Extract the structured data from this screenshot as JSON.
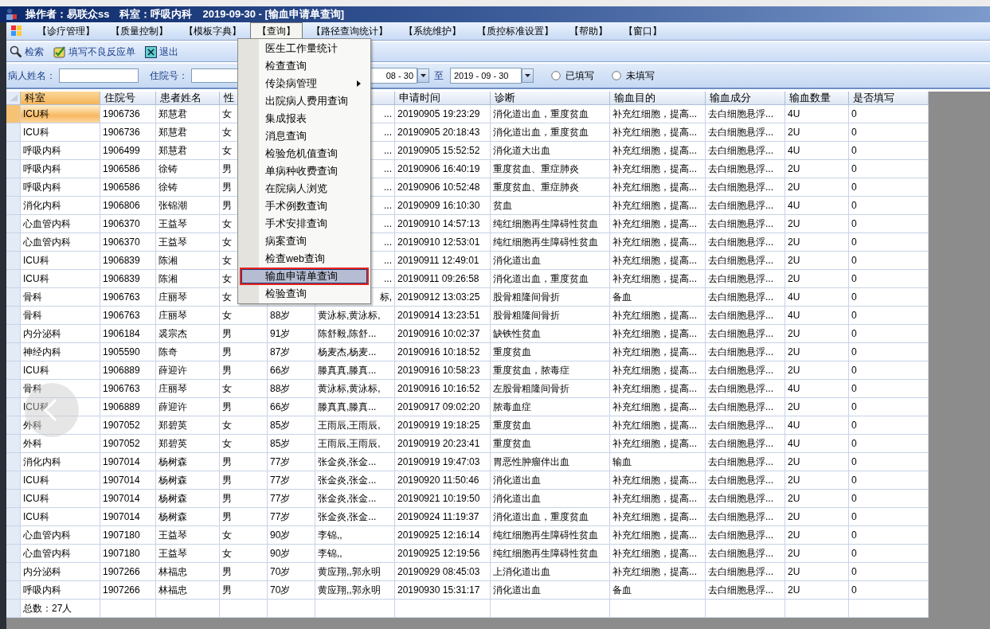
{
  "title": "操作者：易联众ss　科室：呼吸内科　2019-09-30 - [输血申请单查询]",
  "menubar": [
    {
      "label": "【诊疗管理】",
      "selected": false
    },
    {
      "label": "【质量控制】",
      "selected": false
    },
    {
      "label": "【模板字典】",
      "selected": false
    },
    {
      "label": "【查询】",
      "selected": true
    },
    {
      "label": "【路径查询统计】",
      "selected": false
    },
    {
      "label": "【系统维护】",
      "selected": false
    },
    {
      "label": "【质控标准设置】",
      "selected": false
    },
    {
      "label": "【帮助】",
      "selected": false
    },
    {
      "label": "【窗口】",
      "selected": false
    }
  ],
  "toolbar": [
    {
      "label": "检索",
      "kind": "search"
    },
    {
      "label": "填写不良反应单",
      "kind": "form"
    },
    {
      "label": "退出",
      "kind": "exit"
    }
  ],
  "filters": {
    "name_label": "病人姓名：",
    "admission_label": "住院号：",
    "date_from": "08 - 30",
    "to_label": "至",
    "date_to": "2019 - 09 - 30",
    "radios": [
      {
        "label": "已填写",
        "checked": false
      },
      {
        "label": "未填写",
        "checked": false
      }
    ]
  },
  "table": {
    "header": {
      "dept": "科室",
      "id": "住院号",
      "name": "患者姓名",
      "sex": "性",
      "time": "申请时间",
      "diagnosis": "诊断",
      "purpose": "输血目的",
      "component": "输血成分",
      "amount": "输血数量",
      "filled": "是否填写"
    },
    "rows": [
      {
        "selected": true,
        "under_menu": true,
        "dept": "ICU科",
        "id": "1906736",
        "name": "郑慧君",
        "sex": "女",
        "doctor": "...",
        "time": "20190905 19:23:29",
        "diagnosis": "消化道出血，重度贫血",
        "purpose": "补充红细胞，提高...",
        "component": "去白细胞悬浮...",
        "amount": "4U",
        "filled": "0"
      },
      {
        "selected": false,
        "under_menu": true,
        "dept": "ICU科",
        "id": "1906736",
        "name": "郑慧君",
        "sex": "女",
        "doctor": "...",
        "time": "20190905 20:18:43",
        "diagnosis": "消化道出血，重度贫血",
        "purpose": "补充红细胞，提高...",
        "component": "去白细胞悬浮...",
        "amount": "2U",
        "filled": "0"
      },
      {
        "selected": false,
        "under_menu": true,
        "dept": "呼吸内科",
        "id": "1906499",
        "name": "郑慧君",
        "sex": "女",
        "doctor": "...",
        "time": "20190905 15:52:52",
        "diagnosis": "消化道大出血",
        "purpose": "补充红细胞，提高...",
        "component": "去白细胞悬浮...",
        "amount": "4U",
        "filled": "0"
      },
      {
        "selected": false,
        "under_menu": true,
        "dept": "呼吸内科",
        "id": "1906586",
        "name": "徐铸",
        "sex": "男",
        "doctor": "...",
        "time": "20190906 16:40:19",
        "diagnosis": "重度贫血、重症肺炎",
        "purpose": "补充红细胞，提高...",
        "component": "去白细胞悬浮...",
        "amount": "2U",
        "filled": "0"
      },
      {
        "selected": false,
        "under_menu": true,
        "dept": "呼吸内科",
        "id": "1906586",
        "name": "徐铸",
        "sex": "男",
        "doctor": "...",
        "time": "20190906 10:52:48",
        "diagnosis": "重度贫血、重症肺炎",
        "purpose": "补充红细胞，提高...",
        "component": "去白细胞悬浮...",
        "amount": "2U",
        "filled": "0"
      },
      {
        "selected": false,
        "under_menu": true,
        "dept": "消化内科",
        "id": "1906806",
        "name": "张锦潮",
        "sex": "男",
        "doctor": "...",
        "time": "20190909 16:10:30",
        "diagnosis": "贫血",
        "purpose": "补充红细胞，提高...",
        "component": "去白细胞悬浮...",
        "amount": "4U",
        "filled": "0"
      },
      {
        "selected": false,
        "under_menu": true,
        "dept": "心血管内科",
        "id": "1906370",
        "name": "王益琴",
        "sex": "女",
        "doctor": "...",
        "time": "20190910 14:57:13",
        "diagnosis": "纯红细胞再生障碍性贫血",
        "purpose": "补充红细胞，提高...",
        "component": "去白细胞悬浮...",
        "amount": "2U",
        "filled": "0"
      },
      {
        "selected": false,
        "under_menu": true,
        "dept": "心血管内科",
        "id": "1906370",
        "name": "王益琴",
        "sex": "女",
        "doctor": "...",
        "time": "20190910 12:53:01",
        "diagnosis": "纯红细胞再生障碍性贫血",
        "purpose": "补充红细胞，提高...",
        "component": "去白细胞悬浮...",
        "amount": "2U",
        "filled": "0"
      },
      {
        "selected": false,
        "under_menu": true,
        "dept": "ICU科",
        "id": "1906839",
        "name": "陈湘",
        "sex": "女",
        "doctor": "...",
        "time": "20190911 12:49:01",
        "diagnosis": "消化道出血",
        "purpose": "补充红细胞，提高...",
        "component": "去白细胞悬浮...",
        "amount": "2U",
        "filled": "0"
      },
      {
        "selected": false,
        "under_menu": true,
        "dept": "ICU科",
        "id": "1906839",
        "name": "陈湘",
        "sex": "女",
        "doctor": "...",
        "time": "20190911 09:26:58",
        "diagnosis": "消化道出血，重度贫血",
        "purpose": "补充红细胞，提高...",
        "component": "去白细胞悬浮...",
        "amount": "2U",
        "filled": "0"
      },
      {
        "selected": false,
        "under_menu": true,
        "dept": "骨科",
        "id": "1906763",
        "name": "庄丽琴",
        "sex": "女",
        "doctor": "标,",
        "time": "20190912 13:03:25",
        "diagnosis": "股骨粗隆间骨折",
        "purpose": "备血",
        "component": "去白细胞悬浮...",
        "amount": "4U",
        "filled": "0"
      },
      {
        "selected": false,
        "under_menu": false,
        "dept": "骨科",
        "id": "1906763",
        "name": "庄丽琴",
        "sex": "女",
        "age": "88岁",
        "doctor": "黄泳标,黄泳标,",
        "time": "20190914 13:23:51",
        "diagnosis": "股骨粗隆间骨折",
        "purpose": "补充红细胞，提高...",
        "component": "去白细胞悬浮...",
        "amount": "4U",
        "filled": "0"
      },
      {
        "selected": false,
        "under_menu": false,
        "dept": "内分泌科",
        "id": "1906184",
        "name": "裘宗杰",
        "sex": "男",
        "age": "91岁",
        "doctor": "陈舒毅,陈舒...",
        "time": "20190916 10:02:37",
        "diagnosis": "缺铁性贫血",
        "purpose": "补充红细胞，提高...",
        "component": "去白细胞悬浮...",
        "amount": "2U",
        "filled": "0"
      },
      {
        "selected": false,
        "under_menu": false,
        "dept": "神经内科",
        "id": "1905590",
        "name": "陈奇",
        "sex": "男",
        "age": "87岁",
        "doctor": "杨麦杰,杨麦...",
        "time": "20190916 10:18:52",
        "diagnosis": "重度贫血",
        "purpose": "补充红细胞，提高...",
        "component": "去白细胞悬浮...",
        "amount": "2U",
        "filled": "0"
      },
      {
        "selected": false,
        "under_menu": false,
        "dept": "ICU科",
        "id": "1906889",
        "name": "薛迎许",
        "sex": "男",
        "age": "66岁",
        "doctor": "滕真真,滕真...",
        "time": "20190916 10:58:23",
        "diagnosis": "重度贫血，脓毒症",
        "purpose": "补充红细胞，提高...",
        "component": "去白细胞悬浮...",
        "amount": "2U",
        "filled": "0"
      },
      {
        "selected": false,
        "under_menu": false,
        "dept": "骨科",
        "id": "1906763",
        "name": "庄丽琴",
        "sex": "女",
        "age": "88岁",
        "doctor": "黄泳标,黄泳标,",
        "time": "20190916 10:16:52",
        "diagnosis": "左股骨粗隆间骨折",
        "purpose": "补充红细胞，提高...",
        "component": "去白细胞悬浮...",
        "amount": "4U",
        "filled": "0"
      },
      {
        "selected": false,
        "under_menu": false,
        "dept": "ICU科",
        "id": "1906889",
        "name": "薛迎许",
        "sex": "男",
        "age": "66岁",
        "doctor": "滕真真,滕真...",
        "time": "20190917 09:02:20",
        "diagnosis": "脓毒血症",
        "purpose": "补充红细胞，提高...",
        "component": "去白细胞悬浮...",
        "amount": "2U",
        "filled": "0"
      },
      {
        "selected": false,
        "under_menu": false,
        "dept": "外科",
        "id": "1907052",
        "name": "郑碧英",
        "sex": "女",
        "age": "85岁",
        "doctor": "王雨辰,王雨辰,",
        "time": "20190919 19:18:25",
        "diagnosis": "重度贫血",
        "purpose": "补充红细胞，提高...",
        "component": "去白细胞悬浮...",
        "amount": "4U",
        "filled": "0"
      },
      {
        "selected": false,
        "under_menu": false,
        "dept": "外科",
        "id": "1907052",
        "name": "郑碧英",
        "sex": "女",
        "age": "85岁",
        "doctor": "王雨辰,王雨辰,",
        "time": "20190919 20:23:41",
        "diagnosis": "重度贫血",
        "purpose": "补充红细胞，提高...",
        "component": "去白细胞悬浮...",
        "amount": "4U",
        "filled": "0"
      },
      {
        "selected": false,
        "under_menu": false,
        "dept": "消化内科",
        "id": "1907014",
        "name": "杨树森",
        "sex": "男",
        "age": "77岁",
        "doctor": "张金炎,张金...",
        "time": "20190919 19:47:03",
        "diagnosis": "胃恶性肿瘤伴出血",
        "purpose": "输血",
        "component": "去白细胞悬浮...",
        "amount": "2U",
        "filled": "0"
      },
      {
        "selected": false,
        "under_menu": false,
        "dept": "ICU科",
        "id": "1907014",
        "name": "杨树森",
        "sex": "男",
        "age": "77岁",
        "doctor": "张金炎,张金...",
        "time": "20190920 11:50:46",
        "diagnosis": "消化道出血",
        "purpose": "补充红细胞，提高...",
        "component": "去白细胞悬浮...",
        "amount": "2U",
        "filled": "0"
      },
      {
        "selected": false,
        "under_menu": false,
        "dept": "ICU科",
        "id": "1907014",
        "name": "杨树森",
        "sex": "男",
        "age": "77岁",
        "doctor": "张金炎,张金...",
        "time": "20190921 10:19:50",
        "diagnosis": "消化道出血",
        "purpose": "补充红细胞，提高...",
        "component": "去白细胞悬浮...",
        "amount": "2U",
        "filled": "0"
      },
      {
        "selected": false,
        "under_menu": false,
        "dept": "ICU科",
        "id": "1907014",
        "name": "杨树森",
        "sex": "男",
        "age": "77岁",
        "doctor": "张金炎,张金...",
        "time": "20190924 11:19:37",
        "diagnosis": "消化道出血，重度贫血",
        "purpose": "补充红细胞，提高...",
        "component": "去白细胞悬浮...",
        "amount": "2U",
        "filled": "0"
      },
      {
        "selected": false,
        "under_menu": false,
        "dept": "心血管内科",
        "id": "1907180",
        "name": "王益琴",
        "sex": "女",
        "age": "90岁",
        "doctor": "李锦,,",
        "time": "20190925 12:16:14",
        "diagnosis": "纯红细胞再生障碍性贫血",
        "purpose": "补充红细胞，提高...",
        "component": "去白细胞悬浮...",
        "amount": "2U",
        "filled": "0"
      },
      {
        "selected": false,
        "under_menu": false,
        "dept": "心血管内科",
        "id": "1907180",
        "name": "王益琴",
        "sex": "女",
        "age": "90岁",
        "doctor": "李锦,,",
        "time": "20190925 12:19:56",
        "diagnosis": "纯红细胞再生障碍性贫血",
        "purpose": "补充红细胞，提高...",
        "component": "去白细胞悬浮...",
        "amount": "2U",
        "filled": "0"
      },
      {
        "selected": false,
        "under_menu": false,
        "dept": "内分泌科",
        "id": "1907266",
        "name": "林福忠",
        "sex": "男",
        "age": "70岁",
        "doctor": "黄应翔,,郭永明",
        "time": "20190929 08:45:03",
        "diagnosis": "上消化道出血",
        "purpose": "补充红细胞，提高...",
        "component": "去白细胞悬浮...",
        "amount": "2U",
        "filled": "0"
      },
      {
        "selected": false,
        "under_menu": false,
        "dept": "呼吸内科",
        "id": "1907266",
        "name": "林福忠",
        "sex": "男",
        "age": "70岁",
        "doctor": "黄应翔,,郭永明",
        "time": "20190930 15:31:17",
        "diagnosis": "消化道出血",
        "purpose": "备血",
        "component": "去白细胞悬浮...",
        "amount": "2U",
        "filled": "0"
      }
    ],
    "total": "总数：27人"
  },
  "query_menu": {
    "items": [
      {
        "label": "医生工作量统计",
        "selected": false,
        "has_submenu": false
      },
      {
        "label": "检查查询",
        "selected": false,
        "has_submenu": false
      },
      {
        "label": "传染病管理",
        "selected": false,
        "has_submenu": true
      },
      {
        "label": "出院病人费用查询",
        "selected": false,
        "has_submenu": false
      },
      {
        "label": "集成报表",
        "selected": false,
        "has_submenu": false
      },
      {
        "label": "消息查询",
        "selected": false,
        "has_submenu": false
      },
      {
        "label": "检验危机值查询",
        "selected": false,
        "has_submenu": false
      },
      {
        "label": "单病种收费查询",
        "selected": false,
        "has_submenu": false
      },
      {
        "label": "在院病人浏览",
        "selected": false,
        "has_submenu": false
      },
      {
        "label": "手术例数查询",
        "selected": false,
        "has_submenu": false
      },
      {
        "label": "手术安排查询",
        "selected": false,
        "has_submenu": false
      },
      {
        "label": "病案查询",
        "selected": false,
        "has_submenu": false
      },
      {
        "label": "检查web查询",
        "selected": false,
        "has_submenu": false
      },
      {
        "label": "输血申请单查询",
        "selected": true,
        "has_submenu": false
      },
      {
        "label": "检验查询",
        "selected": false,
        "has_submenu": false
      }
    ]
  }
}
